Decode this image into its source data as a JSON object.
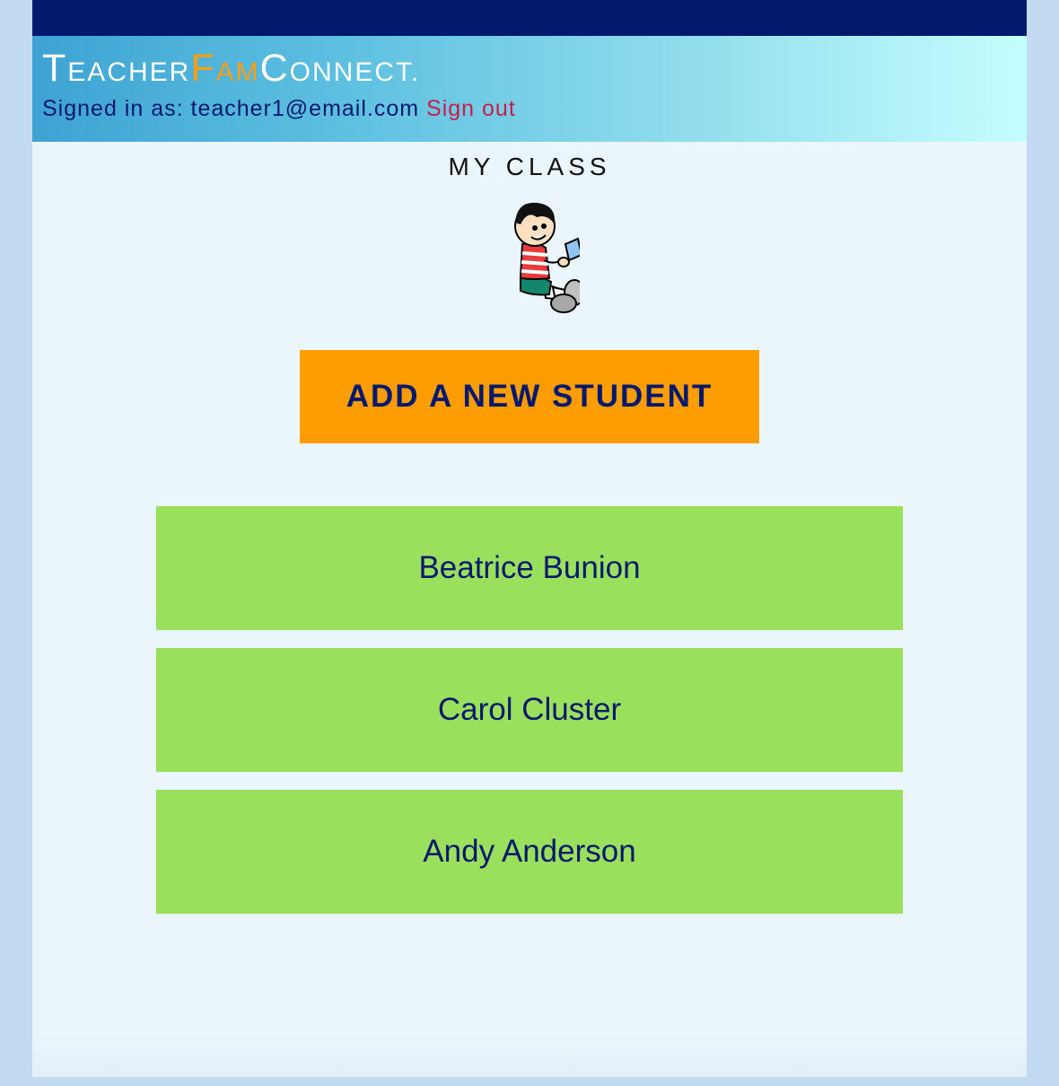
{
  "brand": {
    "part1_initial": "T",
    "part1_rest": "EACHER",
    "part2_initial": "F",
    "part2_rest": "AM",
    "part3_initial": "C",
    "part3_rest": "ONNECT",
    "dot": ".",
    "accent_color": "#f9a012"
  },
  "account": {
    "signed_in_label": "Signed in as:",
    "email": "teacher1@email.com",
    "sign_out_label": "Sign out"
  },
  "main": {
    "title": "MY CLASS",
    "illustration": "boy-reading-icon",
    "add_button_label": "ADD A NEW STUDENT",
    "students": [
      {
        "name": "Beatrice Bunion"
      },
      {
        "name": "Carol Cluster"
      },
      {
        "name": "Andy Anderson"
      }
    ]
  },
  "colors": {
    "topbar": "#02196e",
    "add_button": "#fd9d02",
    "student_card": "#9ae05c",
    "sign_out": "#c81d4a"
  }
}
